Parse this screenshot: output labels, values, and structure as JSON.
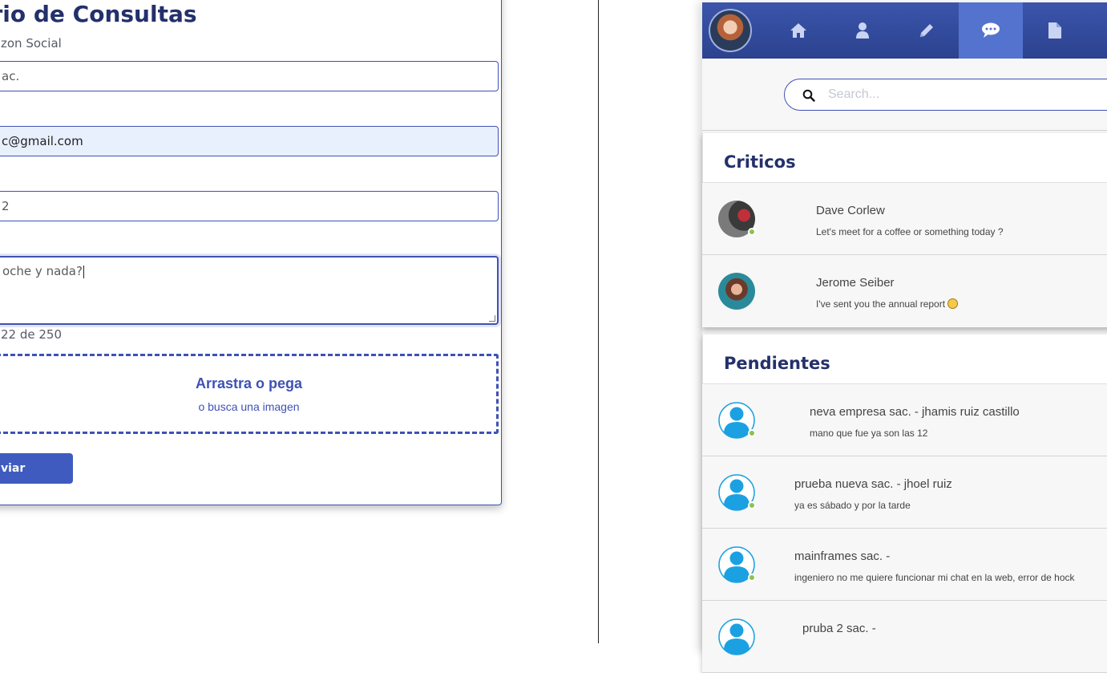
{
  "form": {
    "title": "lario de Consultas",
    "razon_label": "zon Social",
    "razon_value": "ac.",
    "email_value": "c@gmail.com",
    "phone_value": "2",
    "message_value": "oche y nada?",
    "counter": "22 de 250",
    "dropzone_main": "Arrastra o pega",
    "dropzone_sub": "o busca una imagen",
    "send_label": "viar"
  },
  "chat": {
    "nav": [
      {
        "icon": "home-icon"
      },
      {
        "icon": "user-icon"
      },
      {
        "icon": "pencil-icon"
      },
      {
        "icon": "chat-bubble-icon",
        "active": true
      },
      {
        "icon": "document-icon"
      }
    ],
    "search_placeholder": "Search...",
    "sections": [
      {
        "title": "Criticos",
        "items": [
          {
            "name": "Dave Corlew",
            "message": "Let's meet for a coffee or something today ?",
            "avatar": "photo"
          },
          {
            "name": "Jerome Seiber",
            "message": "I've sent you the annual report",
            "avatar": "photo",
            "emoji": "smile-emoji"
          }
        ]
      },
      {
        "title": "Pendientes",
        "items": [
          {
            "name": "neva empresa sac. - jhamis ruiz castillo",
            "message": "mano que fue ya son las 12",
            "avatar": "default-user-icon"
          },
          {
            "name": "prueba nueva sac. - jhoel ruiz",
            "message": "ya es sábado y por la tarde",
            "avatar": "default-user-icon"
          },
          {
            "name": "mainframes sac. -",
            "message": "ingeniero no me quiere funcionar mi chat en la web, error de hock",
            "avatar": "default-user-icon"
          },
          {
            "name": "pruba 2 sac. -",
            "message": "",
            "avatar": "default-user-icon"
          }
        ]
      }
    ],
    "colors": {
      "primary": "#3f51b5",
      "topbar": "#2f4595",
      "active_nav": "#5473cf",
      "title": "#23306b",
      "online": "#8bc34a",
      "avatar_blue": "#1ba1e2"
    }
  }
}
